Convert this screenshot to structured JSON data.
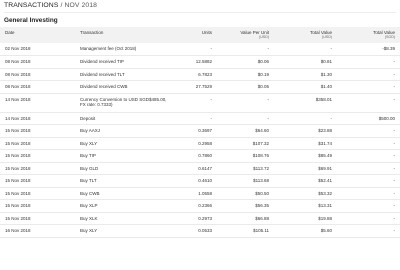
{
  "header": {
    "title": "TRANSACTIONS",
    "separator": "/",
    "period": "NOV 2018"
  },
  "section": {
    "title": "General Investing"
  },
  "table": {
    "columns": {
      "date": "Date",
      "transaction": "Transaction",
      "units": "Units",
      "value_per_unit": "Value Per Unit",
      "value_per_unit_unit": "(USD)",
      "total_value_usd": "Total Value",
      "total_value_usd_unit": "(USD)",
      "total_value_sgd": "Total Value",
      "total_value_sgd_unit": "(SGD)"
    },
    "rows": [
      {
        "date": "02 Nov 2018",
        "transaction": "Management fee (Oct 2018)",
        "units": "-",
        "vpu": "-",
        "tv_usd": "-",
        "tv_sgd": "-$8.39"
      },
      {
        "date": "08 Nov 2018",
        "transaction": "Dividend received TIP",
        "units": "12.5882",
        "vpu": "$0.06",
        "tv_usd": "$0.81",
        "tv_sgd": "-"
      },
      {
        "date": "08 Nov 2018",
        "transaction": "Dividend received TLT",
        "units": "6.7823",
        "vpu": "$0.19",
        "tv_usd": "$1.30",
        "tv_sgd": "-"
      },
      {
        "date": "08 Nov 2018",
        "transaction": "Dividend received CWB",
        "units": "27.7529",
        "vpu": "$0.05",
        "tv_usd": "$1.40",
        "tv_sgd": "-"
      },
      {
        "date": "14 Nov 2018",
        "transaction": "Currency Conversion to USD SGD$485.00, FX rate: 0.7333)",
        "units": "-",
        "vpu": "-",
        "tv_usd": "$358.01",
        "tv_sgd": "-",
        "tall": true
      },
      {
        "date": "14 Nov 2018",
        "transaction": "Deposit",
        "units": "-",
        "vpu": "-",
        "tv_usd": "-",
        "tv_sgd": "$500.00"
      },
      {
        "date": "15 Nov 2018",
        "transaction": "Buy AAXJ",
        "units": "0.3697",
        "vpu": "$64.60",
        "tv_usd": "$23.88",
        "tv_sgd": "-"
      },
      {
        "date": "15 Nov 2018",
        "transaction": "Buy XLY",
        "units": "0.2958",
        "vpu": "$107.32",
        "tv_usd": "$31.74",
        "tv_sgd": "-"
      },
      {
        "date": "15 Nov 2018",
        "transaction": "Buy TIP",
        "units": "0.7860",
        "vpu": "$108.76",
        "tv_usd": "$85.49",
        "tv_sgd": "-"
      },
      {
        "date": "15 Nov 2018",
        "transaction": "Buy GLD",
        "units": "0.6147",
        "vpu": "$113.72",
        "tv_usd": "$69.91",
        "tv_sgd": "-"
      },
      {
        "date": "15 Nov 2018",
        "transaction": "Buy TLT",
        "units": "0.4610",
        "vpu": "$113.68",
        "tv_usd": "$52.41",
        "tv_sgd": "-"
      },
      {
        "date": "15 Nov 2018",
        "transaction": "Buy CWB",
        "units": "1.0558",
        "vpu": "$50.50",
        "tv_usd": "$53.32",
        "tv_sgd": "-"
      },
      {
        "date": "15 Nov 2018",
        "transaction": "Buy XLP",
        "units": "0.2366",
        "vpu": "$56.35",
        "tv_usd": "$13.31",
        "tv_sgd": "-"
      },
      {
        "date": "15 Nov 2018",
        "transaction": "Buy XLK",
        "units": "0.2973",
        "vpu": "$66.88",
        "tv_usd": "$19.88",
        "tv_sgd": "-"
      },
      {
        "date": "16 Nov 2018",
        "transaction": "Buy XLY",
        "units": "0.0533",
        "vpu": "$105.11",
        "tv_usd": "$5.60",
        "tv_sgd": "-"
      }
    ]
  },
  "colors": {
    "header_row_bg": "#f2f2f2",
    "row_divider": "#eaeaea",
    "text": "#333333"
  }
}
